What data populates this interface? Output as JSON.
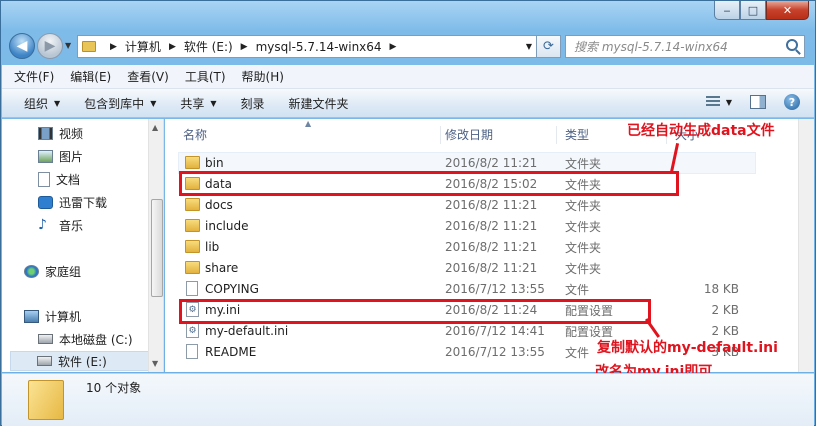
{
  "window": {
    "caption_min": "‒",
    "caption_max": "□",
    "caption_close": "✕"
  },
  "address": {
    "crumbs": [
      "计算机",
      "软件 (E:)",
      "mysql-5.7.14-winx64"
    ],
    "search_placeholder": "搜索 mysql-5.7.14-winx64"
  },
  "menu": [
    "文件(F)",
    "编辑(E)",
    "查看(V)",
    "工具(T)",
    "帮助(H)"
  ],
  "commands": [
    {
      "label": "组织",
      "dropdown": true
    },
    {
      "label": "包含到库中",
      "dropdown": true
    },
    {
      "label": "共享",
      "dropdown": true
    },
    {
      "label": "刻录",
      "dropdown": false
    },
    {
      "label": "新建文件夹",
      "dropdown": false
    }
  ],
  "help_glyph": "?",
  "nav": {
    "items": [
      {
        "label": "视频",
        "icon": "video-icon"
      },
      {
        "label": "图片",
        "icon": "picture-icon"
      },
      {
        "label": "文档",
        "icon": "document-icon"
      },
      {
        "label": "迅雷下载",
        "icon": "thunder-icon"
      },
      {
        "label": "音乐",
        "icon": "music-icon"
      },
      {
        "label": "家庭组",
        "icon": "homegroup-icon"
      },
      {
        "label": "计算机",
        "icon": "computer-icon"
      },
      {
        "label": "本地磁盘 (C:)",
        "icon": "disk-icon"
      },
      {
        "label": "软件 (E:)",
        "icon": "disk-icon"
      }
    ]
  },
  "columns": {
    "name": "名称",
    "date": "修改日期",
    "type": "类型",
    "size": "大小"
  },
  "files": [
    {
      "name": "bin",
      "date": "2016/8/2 11:21",
      "type": "文件夹",
      "size": "",
      "kind": "folder"
    },
    {
      "name": "data",
      "date": "2016/8/2 15:02",
      "type": "文件夹",
      "size": "",
      "kind": "folder"
    },
    {
      "name": "docs",
      "date": "2016/8/2 11:21",
      "type": "文件夹",
      "size": "",
      "kind": "folder"
    },
    {
      "name": "include",
      "date": "2016/8/2 11:21",
      "type": "文件夹",
      "size": "",
      "kind": "folder"
    },
    {
      "name": "lib",
      "date": "2016/8/2 11:21",
      "type": "文件夹",
      "size": "",
      "kind": "folder"
    },
    {
      "name": "share",
      "date": "2016/8/2 11:21",
      "type": "文件夹",
      "size": "",
      "kind": "folder"
    },
    {
      "name": "COPYING",
      "date": "2016/7/12 13:55",
      "type": "文件",
      "size": "18 KB",
      "kind": "file"
    },
    {
      "name": "my.ini",
      "date": "2016/8/2 11:24",
      "type": "配置设置",
      "size": "2 KB",
      "kind": "ini"
    },
    {
      "name": "my-default.ini",
      "date": "2016/7/12 14:41",
      "type": "配置设置",
      "size": "2 KB",
      "kind": "ini"
    },
    {
      "name": "README",
      "date": "2016/7/12 13:55",
      "type": "文件",
      "size": "3 KB",
      "kind": "file"
    }
  ],
  "annotations": {
    "note1": "已经自动生成data文件",
    "note2": "复制默认的my-default.ini",
    "note3": "改名为my.ini即可"
  },
  "details": {
    "count": "10 个对象"
  },
  "colors": {
    "annotation": "#e0141e",
    "folder": "#e2b23f"
  }
}
